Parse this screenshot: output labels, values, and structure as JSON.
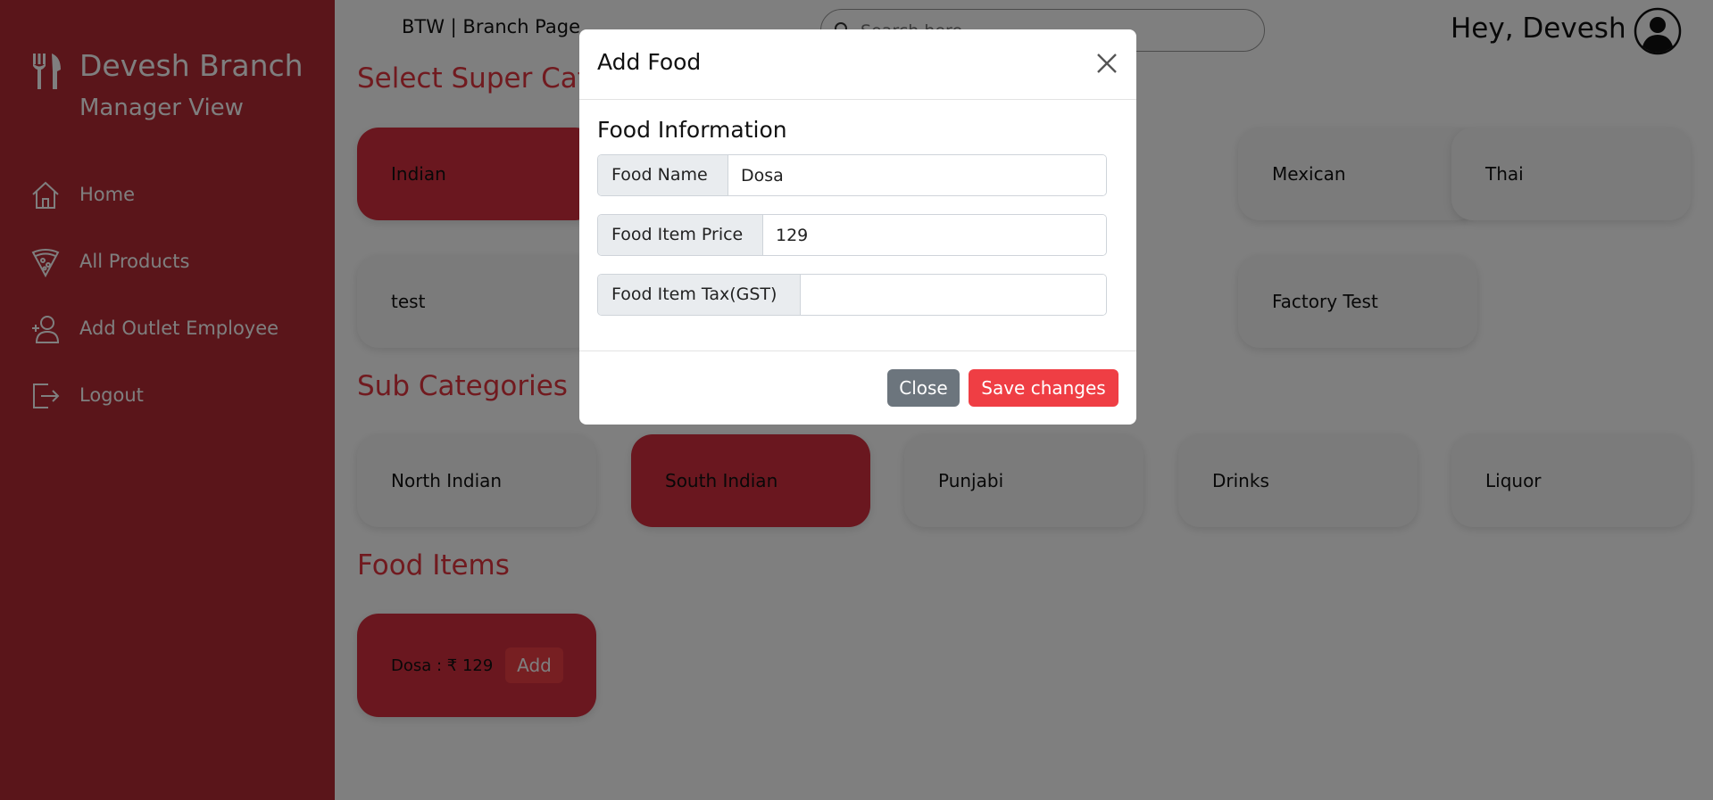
{
  "sidebar": {
    "title": "Devesh Branch",
    "subtitle": "Manager View",
    "items": [
      {
        "label": "Home",
        "icon": "home-icon"
      },
      {
        "label": "All Products",
        "icon": "pizza-icon"
      },
      {
        "label": "Add Outlet Employee",
        "icon": "add-user-icon"
      },
      {
        "label": "Logout",
        "icon": "logout-icon"
      }
    ]
  },
  "header": {
    "page_title": "BTW | Branch Page",
    "search_placeholder": "Search here",
    "greeting": "Hey, Devesh"
  },
  "super_categories": {
    "title": "Select Super Categories",
    "items": [
      "Indian",
      "",
      "",
      "Mexican",
      "Thai",
      "test",
      "",
      "",
      "Factory Test"
    ],
    "selected": "Indian"
  },
  "sub_categories": {
    "title": "Sub Categories",
    "items": [
      "North Indian",
      "South Indian",
      "Punjabi",
      "Drinks",
      "Liquor"
    ],
    "selected": "South Indian"
  },
  "food_items": {
    "title": "Food Items",
    "items": [
      {
        "label": "Dosa : ₹ 129",
        "button": "Add"
      }
    ]
  },
  "modal": {
    "title": "Add Food",
    "form_heading": "Food Information",
    "fields": [
      {
        "label": "Food Name",
        "value": "Dosa"
      },
      {
        "label": "Food Item Price",
        "value": "129"
      },
      {
        "label": "Food Item Tax(GST)",
        "value": ""
      }
    ],
    "close_label": "Close",
    "save_label": "Save changes"
  },
  "colors": {
    "sidebar": "#b52b35",
    "accent": "#ef3e44",
    "active_card": "#d42f3e",
    "section_title": "#e2353f"
  }
}
